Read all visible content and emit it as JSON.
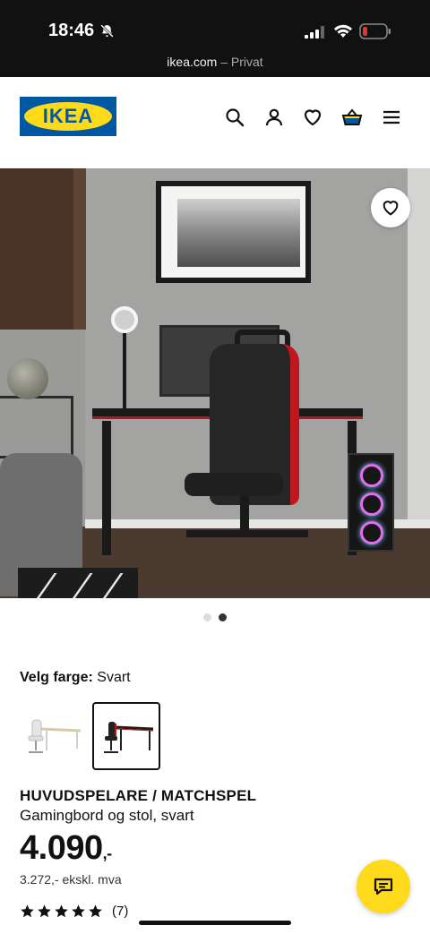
{
  "status_bar": {
    "time": "18:46",
    "icons": [
      "bell-slash-icon",
      "signal-icon",
      "wifi-icon",
      "battery-low-icon"
    ],
    "battery_color": "#e5322b"
  },
  "browser": {
    "host": "ikea.com",
    "separator": " – ",
    "mode": "Privat"
  },
  "header": {
    "logo_text": "IKEA",
    "brand_blue": "#0058a3",
    "brand_yellow": "#ffda1a",
    "icons": [
      "search-icon",
      "account-icon",
      "wishlist-heart-icon",
      "shopping-bag-icon",
      "menu-icon"
    ]
  },
  "gallery": {
    "image_count": 2,
    "active_index": 1,
    "wishlist_icon": "heart-icon"
  },
  "product": {
    "color_label": "Velg farge:",
    "color_value": "Svart",
    "swatches": [
      {
        "variant": "white",
        "selected": false
      },
      {
        "variant": "black",
        "selected": true
      }
    ],
    "name": "HUVUDSPELARE / MATCHSPEL",
    "description": "Gamingbord og stol, svart",
    "price_main": "4.090",
    "price_suffix": ",-",
    "price_ex_vat": "3.272,- ekskl. mva",
    "rating": 5,
    "review_count": "(7)"
  },
  "chat": {
    "icon": "chat-icon"
  }
}
